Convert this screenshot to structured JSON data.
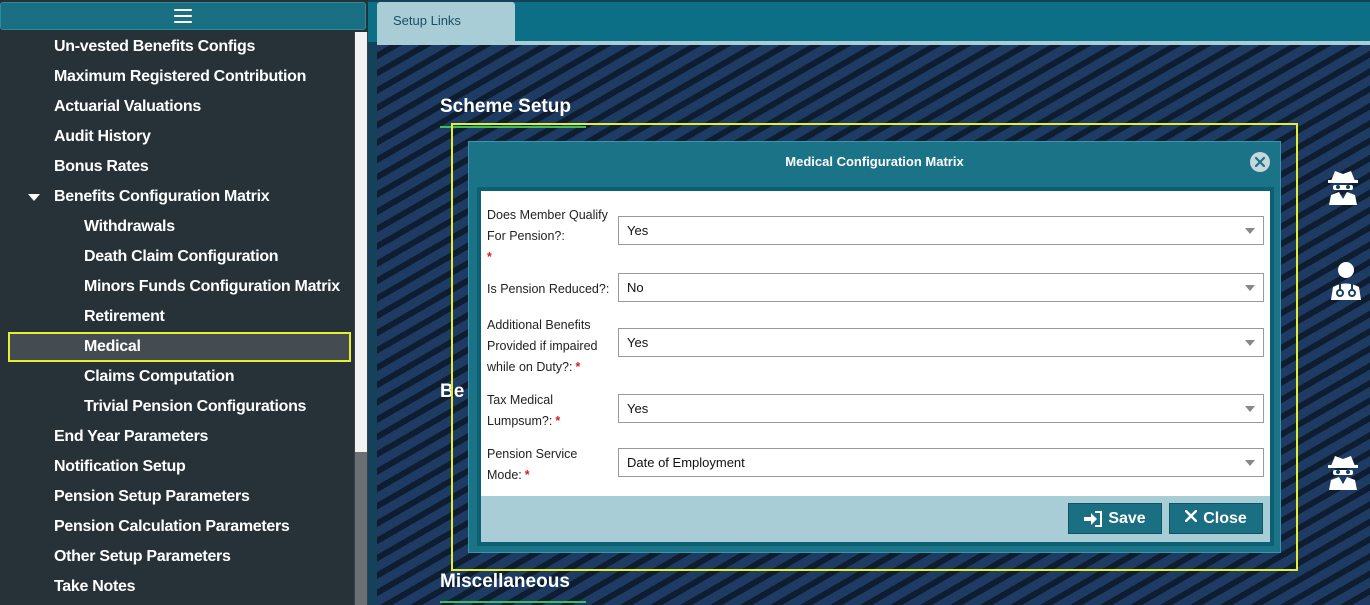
{
  "sidebar": {
    "menu_icon": "hamburger-icon",
    "items": [
      {
        "label": "Un-vested Benefits Configs"
      },
      {
        "label": "Maximum Registered Contribution"
      },
      {
        "label": "Actuarial Valuations"
      },
      {
        "label": "Audit History"
      },
      {
        "label": "Bonus Rates"
      },
      {
        "label": "Benefits Configuration Matrix"
      },
      {
        "label": "Withdrawals"
      },
      {
        "label": "Death Claim Configuration"
      },
      {
        "label": "Minors Funds Configuration Matrix"
      },
      {
        "label": "Retirement"
      },
      {
        "label": "Medical"
      },
      {
        "label": "Claims Computation"
      },
      {
        "label": "Trivial Pension Configurations"
      },
      {
        "label": "End Year Parameters"
      },
      {
        "label": "Notification Setup"
      },
      {
        "label": "Pension Setup Parameters"
      },
      {
        "label": "Pension Calculation Parameters"
      },
      {
        "label": "Other Setup Parameters"
      },
      {
        "label": "Take Notes"
      }
    ]
  },
  "tabs": {
    "setup_links": "Setup Links"
  },
  "sections": {
    "scheme_setup": "Scheme Setup",
    "benefits_partial": "Be",
    "miscellaneous": "Miscellaneous"
  },
  "modal": {
    "title": "Medical Configuration Matrix",
    "fields": [
      {
        "label": "Does Member Qualify For Pension?:",
        "value": "Yes",
        "required": "*"
      },
      {
        "label": "Is Pension Reduced?:",
        "value": "No",
        "required": ""
      },
      {
        "label": "Additional Benefits Provided if impaired while on Duty?:",
        "value": "Yes",
        "required": "*"
      },
      {
        "label": "Tax Medical Lumpsum?:",
        "value": "Yes",
        "required": "*"
      },
      {
        "label": "Pension Service Mode:",
        "value": "Date of Employment",
        "required": "*"
      }
    ],
    "save_label": "Save",
    "close_label": "Close"
  },
  "colors": {
    "highlight": "#e4ef30",
    "header_teal": "#1b6f83",
    "required_red": "#d21f1f"
  }
}
